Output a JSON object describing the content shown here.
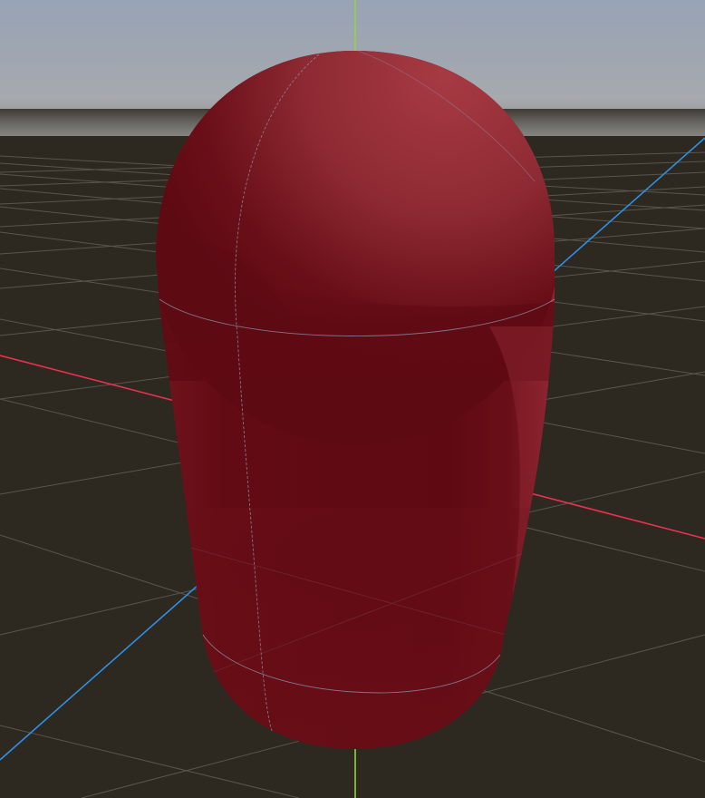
{
  "viewport": {
    "view": "perspective",
    "mesh": "capsule",
    "colors": {
      "sky_top": "#98a4b6",
      "horizon": "#a9aaab",
      "ground": "#2d2820",
      "grid_line": "#6a655c",
      "axis_x": "#e8314d",
      "axis_y": "#8fd63a",
      "axis_z": "#2e8fe6",
      "mesh_base": "#620b14",
      "mesh_light": "#a13640",
      "mesh_dark": "#4e0810",
      "wireframe": "#8a8ea8"
    }
  }
}
